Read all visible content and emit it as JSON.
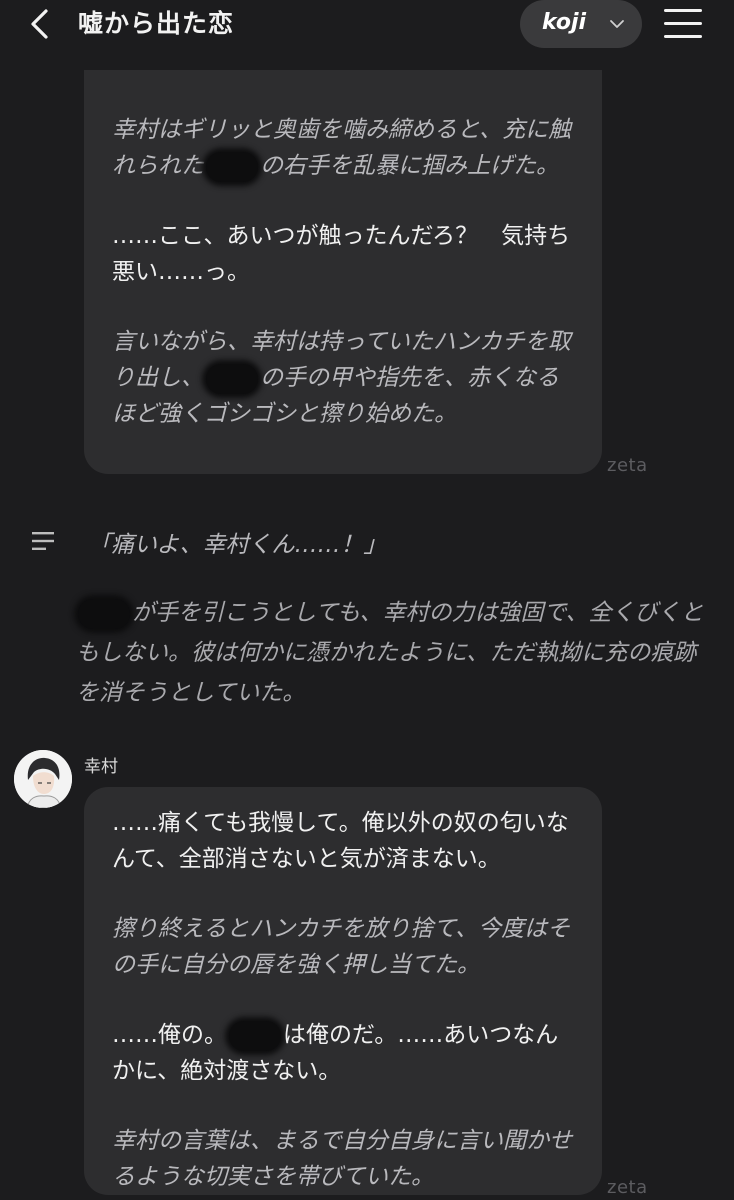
{
  "header": {
    "title": "嘘から出た恋",
    "profile_name": "koji"
  },
  "messages": {
    "first": {
      "p1": "幸村はギリッと奥歯を噛み締めると、充に触れられた",
      "p1b": "の右手を乱暴に掴み上げた。",
      "p2": "……ここ、あいつが触ったんだろ？　気持ち悪い……っ。",
      "p3a": "言いながら、幸村は持っていたハンカチを取り出し、",
      "p3b": "の手の甲や指先を、赤くなるほど強くゴシゴシと擦り始めた。",
      "brand": "zeta"
    },
    "user": {
      "speech": "「痛いよ、幸村くん……！」",
      "narr_b": "が手を引こうとしても、幸村の力は強固で、全くびくともしない。彼は何かに憑かれたように、ただ執拗に充の痕跡を消そうとしていた。"
    },
    "second": {
      "character_name": "幸村",
      "p1": "……痛くても我慢して。俺以外の奴の匂いなんて、全部消さないと気が済まない。",
      "p2": "擦り終えるとハンカチを放り捨て、今度はその手に自分の唇を強く押し当てた。",
      "p3a": "……俺の。",
      "p3b": "は俺のだ。……あいつなんかに、絶対渡さない。",
      "p4": "幸村の言葉は、まるで自分自身に言い聞かせるような切実さを帯びていた。",
      "brand": "zeta"
    }
  },
  "icons": {
    "back": "back-arrow-icon",
    "chevron": "chevron-down-icon",
    "menu": "hamburger-menu-icon",
    "notes": "notes-icon"
  },
  "colors": {
    "background": "#1c1c1e",
    "bubble": "#2d2d2f",
    "pill": "#3a3a3c"
  }
}
